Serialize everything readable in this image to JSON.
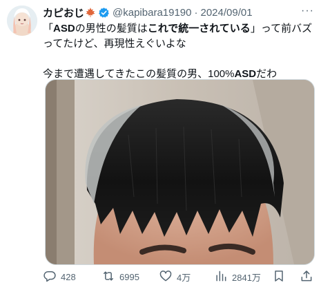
{
  "tweet": {
    "author_name": "カピおじ",
    "handle": "@kapibara19190",
    "separator": "·",
    "date": "2024/09/01",
    "more": "···",
    "line1_prefix": "「",
    "line1_bold": "ASD",
    "line1_mid": "の男性の髪質は",
    "line1_bold2": "これで統一されている",
    "line1_suffix": "」って前バズ",
    "line2": "ってたけど、再現性えぐいよな",
    "line3_prefix": "今まで遭遇してきたこの髪質の男、100%",
    "line3_bold": "ASD",
    "line3_suffix": "だわ"
  },
  "actions": {
    "replies": "428",
    "reposts": "6995",
    "likes": "4万",
    "views": "2841万"
  },
  "icons": {
    "leaf": "maple-leaf-icon",
    "verified": "verified-badge-icon",
    "reply": "reply-icon",
    "repost": "repost-icon",
    "like": "like-icon",
    "views": "views-icon",
    "bookmark": "bookmark-icon",
    "share": "share-icon"
  },
  "colors": {
    "text": "#0f1419",
    "secondary": "#536471",
    "verified": "#1d9bf0",
    "leaf": "#e0663a"
  }
}
